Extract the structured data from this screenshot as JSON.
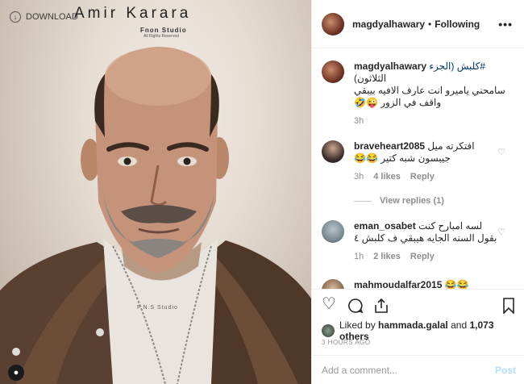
{
  "media": {
    "download_label": "DOWNLOAD",
    "brand_title": "Amir Karara",
    "studio": "Fnon Studio",
    "rights": "All Rights Reserved",
    "watermark": "F.N.S  Studio"
  },
  "header": {
    "username": "magdyalhawary",
    "separator": "•",
    "follow_state": "Following",
    "more": "•••"
  },
  "caption": {
    "username": "magdyalhawary",
    "text_line1": "#كلبش (الجزء",
    "text_line2": "الثلاثون)",
    "text_line3": "سامحني ياميرو انت عارف الافيه بيبقي",
    "text_line4": "واقف في الزور 😜🤣",
    "time": "3h"
  },
  "comments": [
    {
      "username": "braveheart2085",
      "text_line1": "افتكرته ميل",
      "text_line2": "جيبسون شبه كتير 😂😂",
      "time": "3h",
      "likes": "4 likes",
      "reply": "Reply"
    },
    {
      "username": "eman_osabet",
      "text_line1": "لسه امبارح كنت",
      "text_line2": "بقول السنه الجايه هيبقي ف كلبش ٤",
      "time": "1h",
      "likes": "2 likes",
      "reply": "Reply"
    },
    {
      "username": "mahmoudalfar2015",
      "text_line1": "😂😂"
    }
  ],
  "view_replies": "View replies (1)",
  "liked_by": {
    "prefix": "Liked by",
    "user": "hammada.galal",
    "middle": "and",
    "others": "1,073 others"
  },
  "timestamp": "3 HOURS AGO",
  "add_comment": {
    "placeholder": "Add a comment...",
    "post": "Post"
  }
}
